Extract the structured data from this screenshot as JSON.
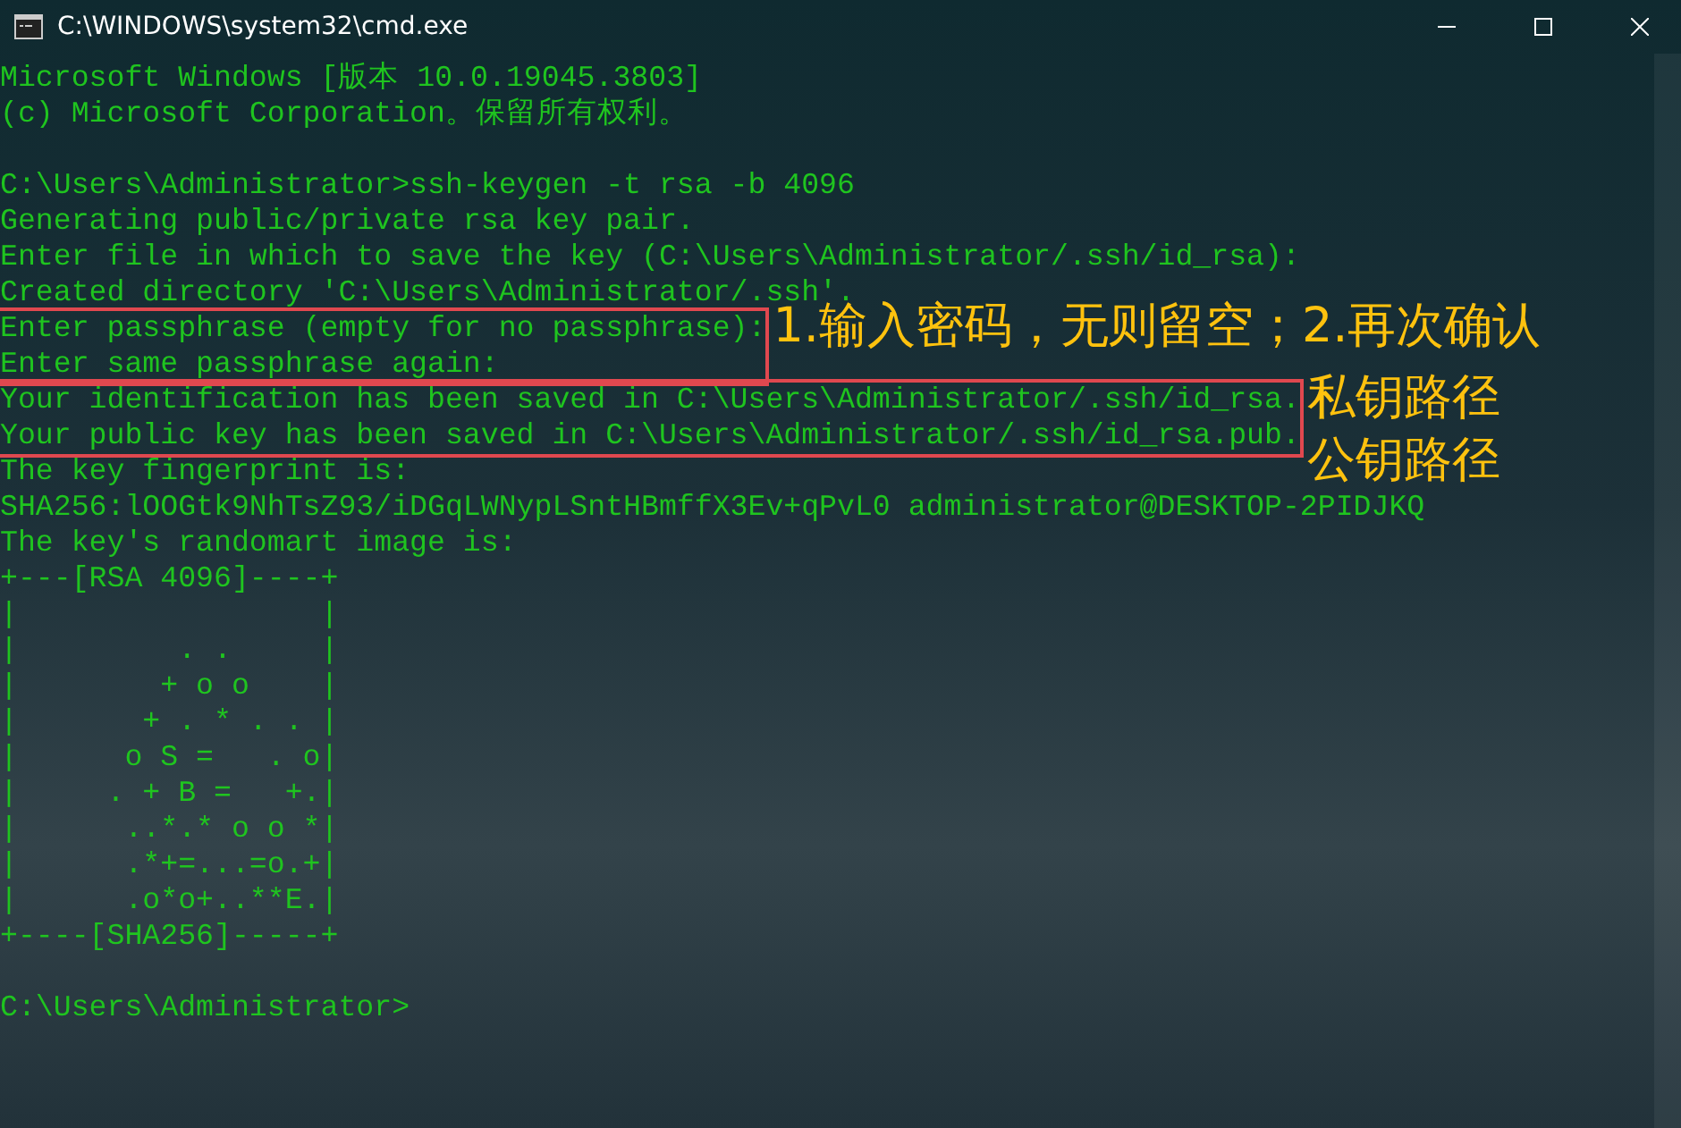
{
  "window": {
    "title": "C:\\WINDOWS\\system32\\cmd.exe"
  },
  "terminal": {
    "paragraphs": [
      [
        {
          "kind": "plain",
          "lines": [
            "Microsoft Windows [版本 10.0.19045.3803]",
            "(c) Microsoft Corporation。保留所有权利。"
          ]
        }
      ],
      [
        {
          "kind": "plain",
          "lines": [
            "C:\\Users\\Administrator>ssh-keygen -t rsa -b 4096",
            "Generating public/private rsa key pair.",
            "Enter file in which to save the key (C:\\Users\\Administrator/.ssh/id_rsa):",
            "Created directory 'C:\\Users\\Administrator/.ssh'."
          ]
        },
        {
          "kind": "boxed",
          "lines": [
            "Enter passphrase (empty for no passphrase):",
            "Enter same passphrase again:"
          ],
          "notes": [
            "1.输入密码，无则留空；2.再次确认"
          ]
        },
        {
          "kind": "boxed",
          "lines": [
            "Your identification has been saved in C:\\Users\\Administrator/.ssh/id_rsa.",
            "Your public key has been saved in C:\\Users\\Administrator/.ssh/id_rsa.pub."
          ],
          "notes": [
            "私钥路径",
            "公钥路径"
          ]
        },
        {
          "kind": "plain",
          "lines": [
            "The key fingerprint is:",
            "SHA256:lOOGtk9NhTsZ93/iDGqLWNypLSntHBmffX3Ev+qPvL0 administrator@DESKTOP-2PIDJKQ",
            "The key's randomart image is:",
            "+---[RSA 4096]----+",
            "|                 |",
            "|         . .     |",
            "|        + o o    |",
            "|       + . * . . |",
            "|      o S =   . o|",
            "|     . + B =   +.|",
            "|      ..*.* o o *|",
            "|      .*+=...=o.+|",
            "|      .o*o+..**E.|",
            "+----[SHA256]-----+"
          ]
        }
      ],
      [
        {
          "kind": "plain",
          "lines": [
            "C:\\Users\\Administrator>"
          ]
        }
      ]
    ]
  }
}
